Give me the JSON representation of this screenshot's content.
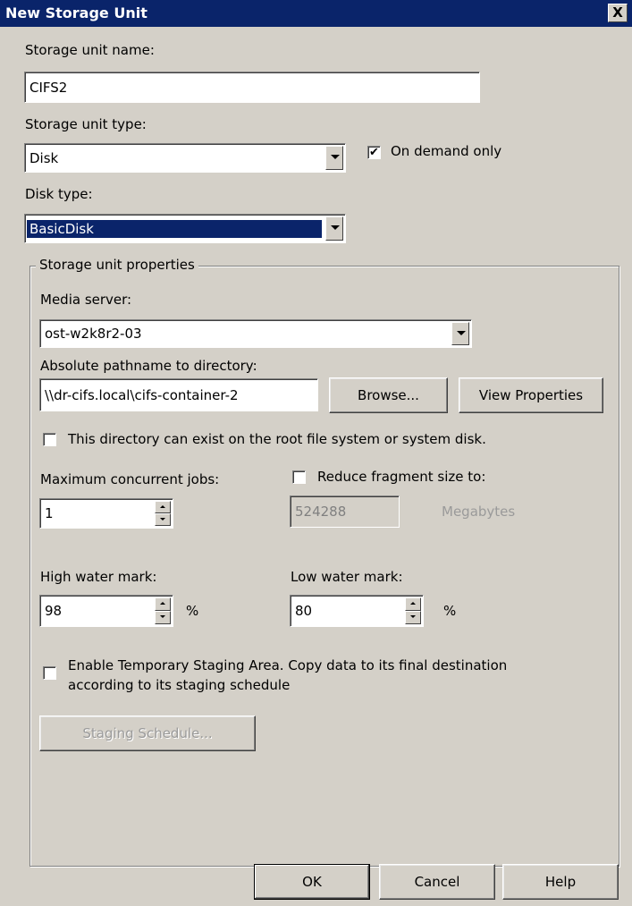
{
  "window": {
    "title": "New Storage Unit",
    "close_glyph": "X"
  },
  "storage_unit_name": {
    "label": "Storage unit name:",
    "value": "CIFS2"
  },
  "storage_unit_type": {
    "label": "Storage unit type:",
    "value": "Disk"
  },
  "on_demand_only": {
    "label": "On demand only",
    "checked": true
  },
  "disk_type": {
    "label": "Disk type:",
    "value": "BasicDisk"
  },
  "properties": {
    "legend": "Storage unit properties",
    "media_server": {
      "label": "Media server:",
      "value": "ost-w2k8r2-03"
    },
    "path": {
      "label": "Absolute pathname to directory:",
      "value": "\\\\dr-cifs.local\\cifs-container-2"
    },
    "browse_label": "Browse...",
    "view_properties_label": "View Properties",
    "root_fs": {
      "label": "This directory can exist on the root file system or system disk.",
      "checked": false
    },
    "max_jobs": {
      "label": "Maximum concurrent jobs:",
      "value": "1"
    },
    "reduce_fragment": {
      "label": "Reduce fragment size to:",
      "checked": false,
      "value": "524288",
      "unit": "Megabytes"
    },
    "high_water": {
      "label": "High water mark:",
      "value": "98",
      "unit": "%"
    },
    "low_water": {
      "label": "Low water mark:",
      "value": "80",
      "unit": "%"
    },
    "staging": {
      "label_line1": "Enable Temporary Staging Area. Copy data to its final destination",
      "label_line2": "according to its staging schedule",
      "checked": false
    },
    "staging_schedule_label": "Staging Schedule..."
  },
  "footer": {
    "ok": "OK",
    "cancel": "Cancel",
    "help": "Help"
  },
  "colors": {
    "title_bar": "#0a246a",
    "face": "#d4d0c8",
    "selection": "#0a246a"
  }
}
